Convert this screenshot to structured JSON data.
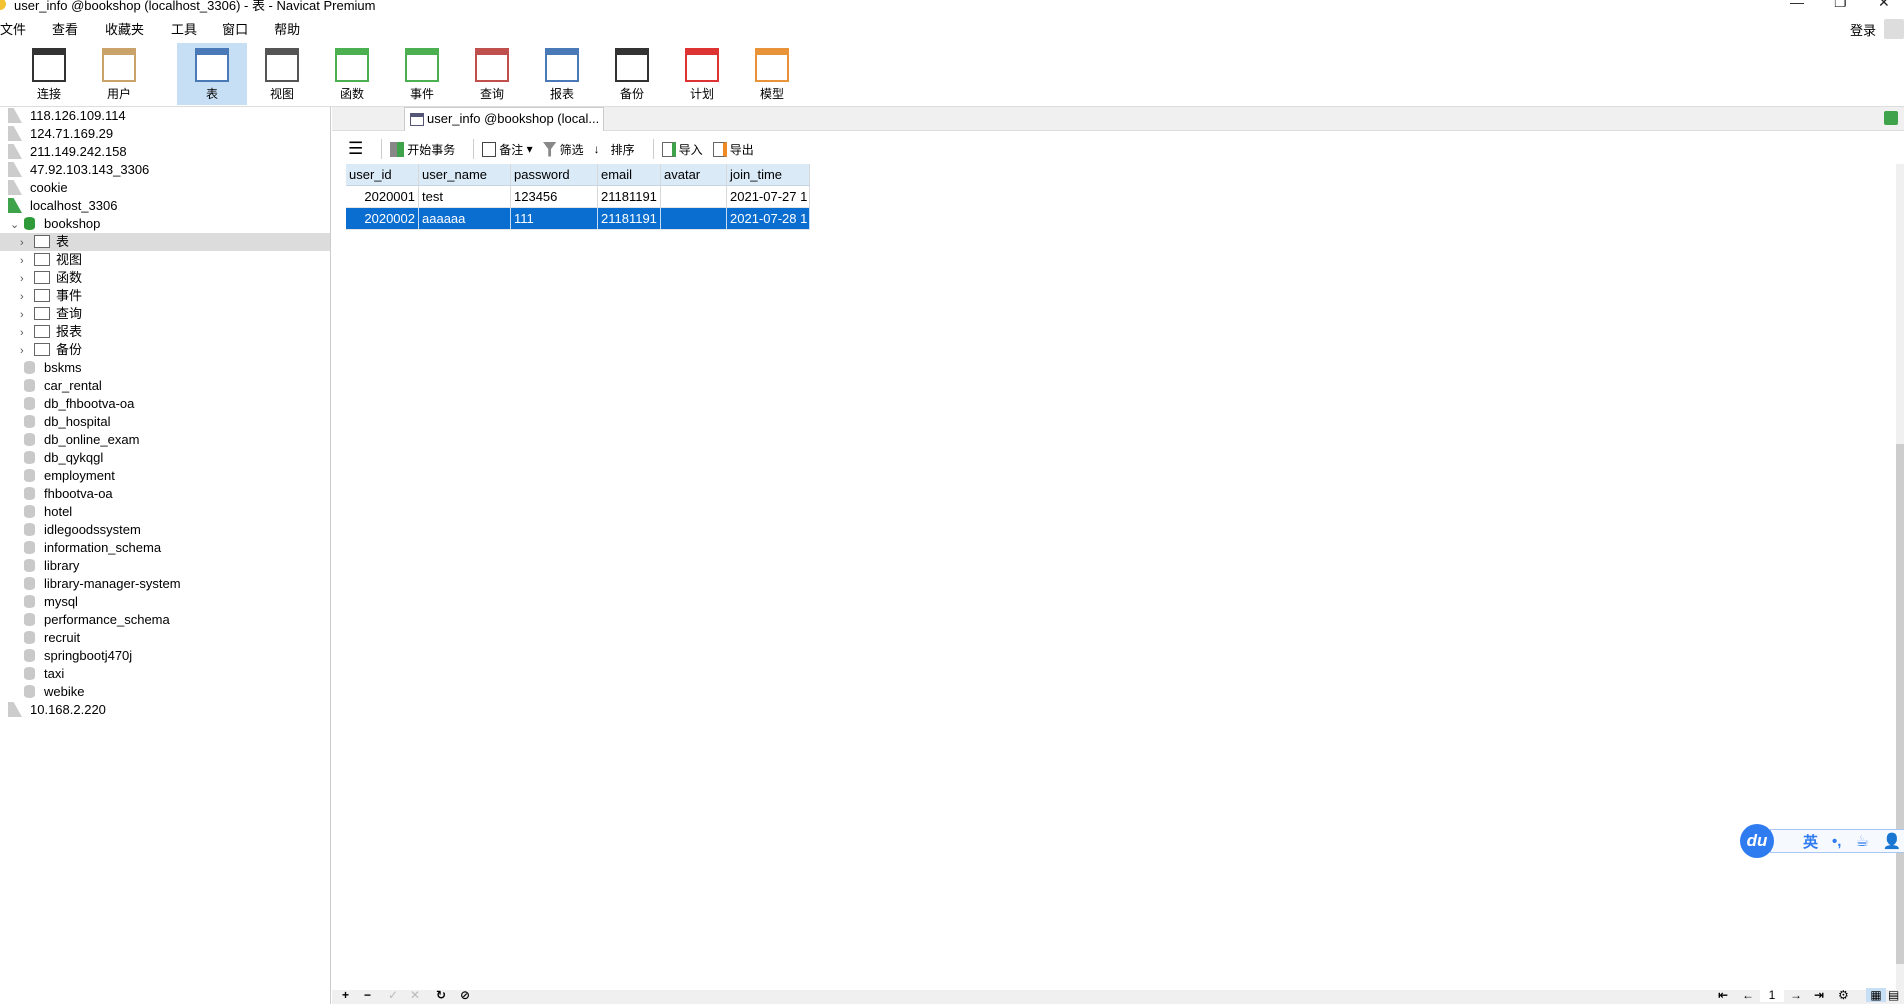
{
  "window": {
    "title": "user_info @bookshop (localhost_3306) - 表 - Navicat Premium",
    "minimize": "—",
    "restore": "❐",
    "close": "✕"
  },
  "menu": [
    "文件",
    "查看",
    "收藏夹",
    "工具",
    "窗口",
    "帮助"
  ],
  "login": "登录",
  "toolbar": [
    {
      "label": "连接",
      "icon": "connection-icon"
    },
    {
      "label": "用户",
      "icon": "user-icon"
    },
    {
      "label": "表",
      "icon": "table-icon",
      "active": true
    },
    {
      "label": "视图",
      "icon": "view-icon"
    },
    {
      "label": "函数",
      "icon": "function-icon"
    },
    {
      "label": "事件",
      "icon": "event-icon"
    },
    {
      "label": "查询",
      "icon": "query-icon"
    },
    {
      "label": "报表",
      "icon": "report-icon"
    },
    {
      "label": "备份",
      "icon": "backup-icon"
    },
    {
      "label": "计划",
      "icon": "schedule-icon"
    },
    {
      "label": "模型",
      "icon": "model-icon"
    }
  ],
  "sidebar": {
    "servers_top": [
      "118.126.109.114",
      "124.71.169.29",
      "211.149.242.158",
      "47.92.103.143_3306",
      "cookie",
      "localhost_3306"
    ],
    "open_db": "bookshop",
    "db_children": [
      "表",
      "视图",
      "函数",
      "事件",
      "查询",
      "报表",
      "备份"
    ],
    "databases": [
      "bskms",
      "car_rental",
      "db_fhbootva-oa",
      "db_hospital",
      "db_online_exam",
      "db_qykqgl",
      "employment",
      "fhbootva-oa",
      "hotel",
      "idlegoodssystem",
      "information_schema",
      "library",
      "library-manager-system",
      "mysql",
      "performance_schema",
      "recruit",
      "springbootj470j",
      "taxi",
      "webike"
    ],
    "servers_bottom": [
      "10.168.2.220"
    ]
  },
  "tab": {
    "label": "user_info @bookshop (local..."
  },
  "data_toolbar": {
    "begin_tx": "开始事务",
    "note": "备注",
    "filter": "筛选",
    "sort": "排序",
    "import": "导入",
    "export": "导出"
  },
  "table": {
    "columns": [
      "user_id",
      "user_name",
      "password",
      "email",
      "avatar",
      "join_time"
    ],
    "rows": [
      [
        "2020001",
        "test",
        "123456",
        "21181191",
        "",
        "2021-07-27 1"
      ],
      [
        "2020002",
        "aaaaaa",
        "111",
        "21181191",
        "",
        "2021-07-28 1"
      ]
    ],
    "selected_row": 1
  },
  "pager": {
    "page": "1"
  },
  "ime": {
    "logo": "du",
    "lang": "英",
    "punct": "•,"
  }
}
